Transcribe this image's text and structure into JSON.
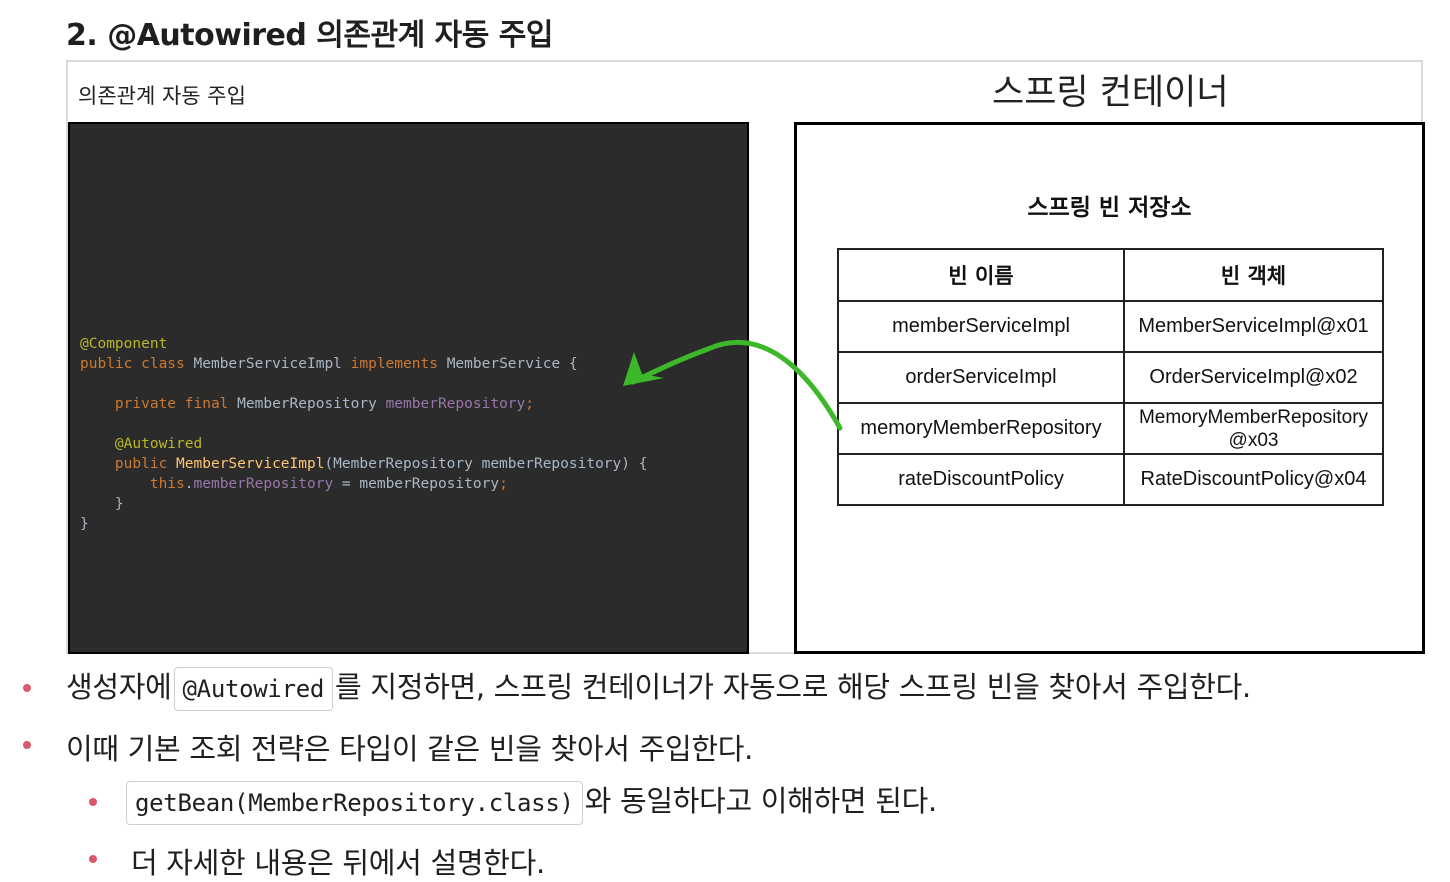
{
  "heading": "2. @Autowired 의존관계 자동 주입",
  "figure": {
    "caption": "의존관계 자동 주입",
    "container_title": "스프링 컨테이너",
    "store_title": "스프링 빈 저장소",
    "arrow_color": "#3db82a",
    "table": {
      "headers": [
        "빈 이름",
        "빈 객체"
      ],
      "rows": [
        [
          "memberServiceImpl",
          "MemberServiceImpl@x01"
        ],
        [
          "orderServiceImpl",
          "OrderServiceImpl@x02"
        ],
        [
          "memoryMemberRepository",
          "MemoryMemberRepository @x03"
        ],
        [
          "rateDiscountPolicy",
          "RateDiscountPolicy@x04"
        ]
      ]
    },
    "code": {
      "annotation_component": "@Component",
      "class_kw": "public class",
      "class_name": "MemberServiceImpl",
      "implements_kw": "implements",
      "interface_name": "MemberService",
      "open_brace": "{",
      "field_mods": "private final",
      "field_type": "MemberRepository",
      "field_name": "memberRepository",
      "semicolon": ";",
      "annotation_autowired": "@Autowired",
      "public_kw": "public",
      "ctor_name": "MemberServiceImpl",
      "ctor_params": "(MemberRepository memberRepository) {",
      "this_kw": "this",
      "dot": ".",
      "assign_rhs": " = memberRepository",
      "close_inner": "}",
      "close_outer": "}"
    }
  },
  "bullets": {
    "b1_before": "생성자에",
    "b1_code": "@Autowired",
    "b1_after": "를 지정하면, 스프링 컨테이너가 자동으로 해당 스프링 빈을 찾아서 주입한다.",
    "b2": "이때 기본 조회 전략은 타입이 같은 빈을 찾아서 주입한다.",
    "b3_code": "getBean(MemberRepository.class)",
    "b3_after": "와 동일하다고 이해하면 된다.",
    "b4": "더 자세한 내용은 뒤에서 설명한다."
  }
}
